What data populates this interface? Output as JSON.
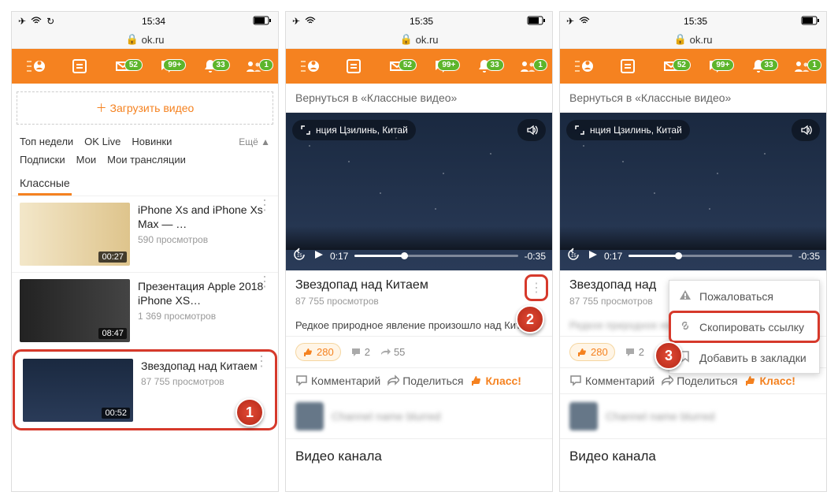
{
  "status": {
    "time1": "15:34",
    "time2": "15:35",
    "time3": "15:35"
  },
  "url": "ok.ru",
  "nav_badges": {
    "messages": "52",
    "chat": "99+",
    "notif": "33",
    "friends": "1"
  },
  "panel1": {
    "upload": "Загрузить видео",
    "tabs": [
      "Топ недели",
      "OK Live",
      "Новинки"
    ],
    "more": "Ещё ▲",
    "tabs2": [
      "Подписки",
      "Мои",
      "Мои трансляции"
    ],
    "tab_active": "Классные",
    "videos": [
      {
        "title": "iPhone Xs and iPhone Xs Max — …",
        "views": "590 просмотров",
        "duration": "00:27"
      },
      {
        "title": "Презентация Apple 2018 iPhone XS…",
        "views": "1 369 просмотров",
        "duration": "08:47"
      },
      {
        "title": "Звездопад над Китаем",
        "views": "87 755 просмотров",
        "duration": "00:52"
      }
    ]
  },
  "panel2": {
    "back": "Вернуться в «Классные видео»",
    "loc": "нция Цзилинь, Китай",
    "cur": "0:17",
    "rem": "-0:35",
    "title": "Звездопад над Китаем",
    "views": "87 755 просмотров",
    "desc": "Редкое природное явление произошло над Китаем",
    "likes": "280",
    "comments": "2",
    "shares": "55",
    "actions": [
      "Комментарий",
      "Поделиться",
      "Класс!"
    ],
    "section": "Видео канала"
  },
  "panel3": {
    "title_short": "Звездопад над",
    "menu": [
      "Пожаловаться",
      "Скопировать ссылку",
      "Добавить в закладки"
    ]
  }
}
